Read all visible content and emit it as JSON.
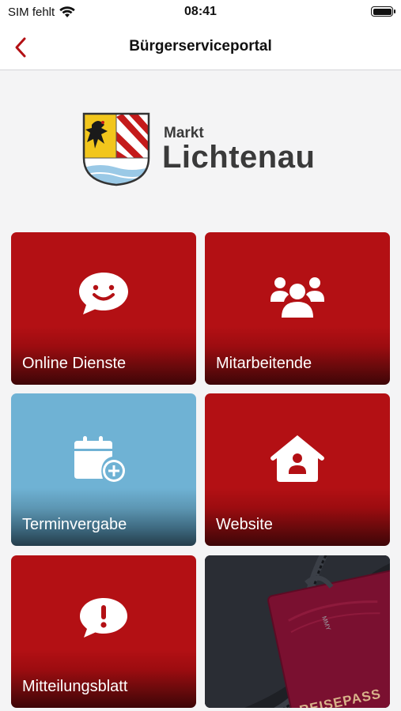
{
  "status_bar": {
    "carrier": "SIM fehlt",
    "time": "08:41"
  },
  "nav": {
    "title": "Bürgerserviceportal",
    "back_icon": "chevron-left-icon"
  },
  "logo": {
    "line1": "Markt",
    "line2": "Lichtenau"
  },
  "tiles": [
    {
      "label": "Online Dienste",
      "icon": "chat-smile-icon"
    },
    {
      "label": "Mitarbeitende",
      "icon": "people-group-icon"
    },
    {
      "label": "Terminvergabe",
      "icon": "calendar-add-icon"
    },
    {
      "label": "Website",
      "icon": "home-user-icon"
    },
    {
      "label": "Mitteilungsblatt",
      "icon": "chat-alert-icon"
    },
    {
      "label": "",
      "image_text": "REISEPASS",
      "icon": "passport-image"
    }
  ],
  "colors": {
    "accent": "#b31014",
    "blue_tile": "#6fb2d4"
  }
}
